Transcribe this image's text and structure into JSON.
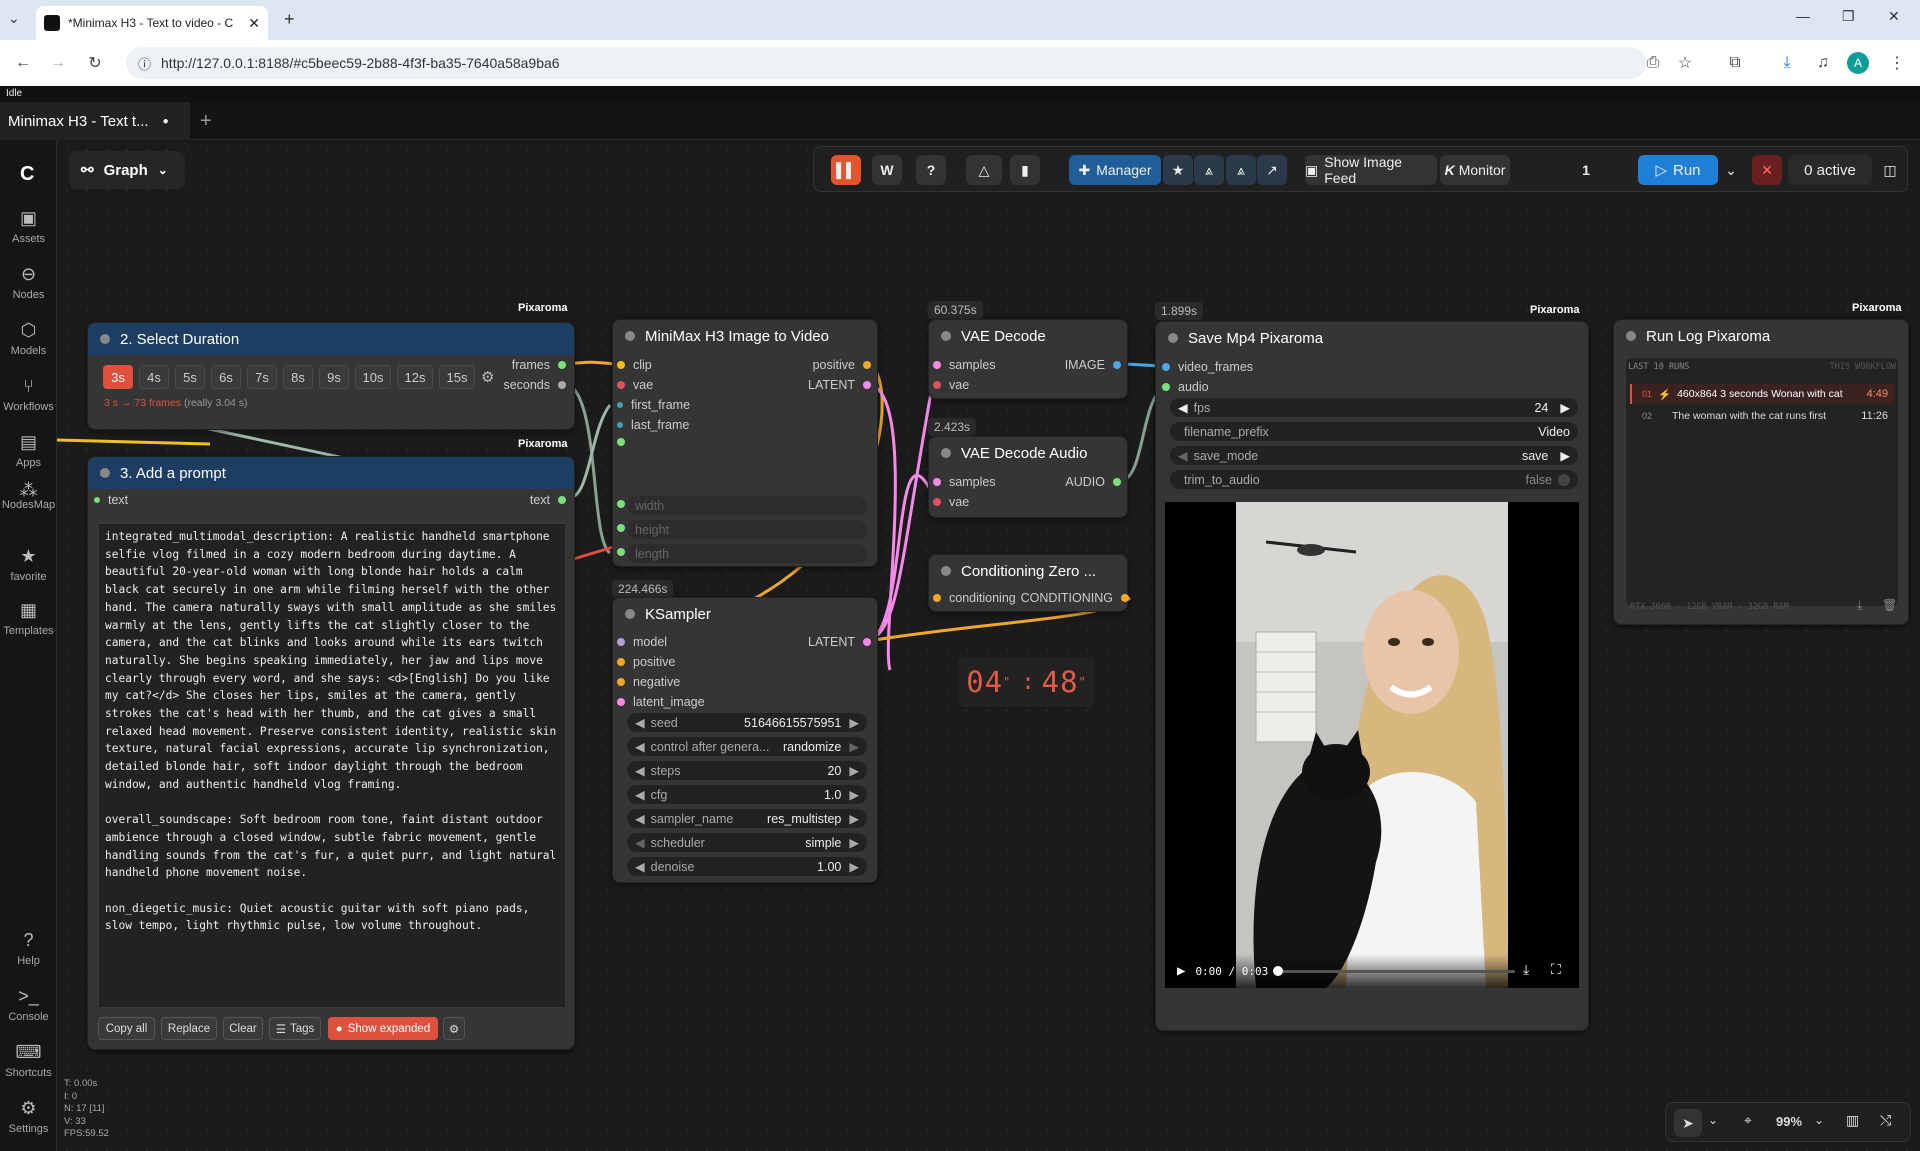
{
  "browser": {
    "tab_title": "*Minimax H3 - Text to video - C",
    "url": "http://127.0.0.1:8188/#c5beec59-2b88-4f3f-ba35-7640a58a9ba6",
    "profile_initial": "A"
  },
  "app": {
    "status": "Idle",
    "workflow_tab": "Minimax H3 - Text t...",
    "graph_label": "Graph",
    "sidebar": [
      "Assets",
      "Nodes",
      "Models",
      "Workflows",
      "Apps",
      "NodesMap",
      "favorite",
      "Templates",
      "Help",
      "Console",
      "Shortcuts",
      "Settings"
    ],
    "stats": [
      "T: 0.00s",
      "I: 0",
      "N: 17 [11]",
      "V: 33",
      "FPS:59.52"
    ],
    "zoom": "99%"
  },
  "topbar": {
    "manager": "Manager",
    "show_image_feed": "Show Image Feed",
    "monitor": "Monitor",
    "queue_count": "1",
    "run": "Run",
    "active": "0 active"
  },
  "duration_node": {
    "brand": "Pixaroma",
    "title": "2. Select Duration",
    "options": [
      "3s",
      "4s",
      "5s",
      "6s",
      "7s",
      "8s",
      "9s",
      "10s",
      "12s",
      "15s"
    ],
    "selected": "3s",
    "info_main": "3 s → 73 frames",
    "info_sub": "(really 3.04 s)",
    "out1": "frames",
    "out2": "seconds"
  },
  "prompt_node": {
    "brand": "Pixaroma",
    "title": "3. Add a prompt",
    "in": "text",
    "out": "text",
    "text": "integrated_multimodal_description: A realistic handheld smartphone\nselfie vlog filmed in a cozy modern bedroom during daytime. A\nbeautiful 20-year-old woman with long blonde hair holds a calm\nblack cat securely in one arm while filming herself with the other\nhand. The camera naturally sways with small amplitude as she smiles\nwarmly at the lens, gently lifts the cat slightly closer to the\ncamera, and the cat blinks and looks around while its ears twitch\nnaturally. She begins speaking immediately, her jaw and lips move\nclearly through every word, and she says: <d>[English] Do you like\nmy cat?</d> She closes her lips, smiles at the camera, gently\nstrokes the cat's head with her thumb, and the cat gives a small\nrelaxed head movement. Preserve consistent identity, realistic skin\ntexture, natural facial expressions, accurate lip synchronization,\ndetailed blonde hair, soft indoor daylight through the bedroom\nwindow, and authentic handheld vlog framing.\n\noverall_soundscape: Soft bedroom room tone, faint distant outdoor\nambience through a closed window, subtle fabric movement, gentle\nhandling sounds from the cat's fur, a quiet purr, and light natural\nhandheld phone movement noise.\n\nnon_diegetic_music: Quiet acoustic guitar with soft piano pads,\nslow tempo, light rhythmic pulse, low volume throughout.",
    "buttons": [
      "Copy all",
      "Replace",
      "Clear",
      "Tags",
      "Show expanded"
    ]
  },
  "minimax_node": {
    "title": "MiniMax H3 Image to Video",
    "inputs": [
      "clip",
      "vae",
      "first_frame",
      "last_frame"
    ],
    "outputs": [
      "positive",
      "LATENT"
    ],
    "widgets": [
      "width",
      "height",
      "length"
    ]
  },
  "ksampler": {
    "time": "224.466s",
    "title": "KSampler",
    "inputs": [
      "model",
      "positive",
      "negative",
      "latent_image"
    ],
    "output": "LATENT",
    "widgets": [
      {
        "label": "seed",
        "value": "51646615575951"
      },
      {
        "label": "control after genera...",
        "value": "randomize"
      },
      {
        "label": "steps",
        "value": "20"
      },
      {
        "label": "cfg",
        "value": "1.0"
      },
      {
        "label": "sampler_name",
        "value": "res_multistep"
      },
      {
        "label": "scheduler",
        "value": "simple"
      },
      {
        "label": "denoise",
        "value": "1.00"
      }
    ]
  },
  "vae_decode": {
    "time": "60.375s",
    "title": "VAE Decode",
    "inputs": [
      "samples",
      "vae"
    ],
    "output": "IMAGE"
  },
  "vae_decode_audio": {
    "time": "2.423s",
    "title": "VAE Decode Audio",
    "inputs": [
      "samples",
      "vae"
    ],
    "output": "AUDIO"
  },
  "cond_zero": {
    "title": "Conditioning Zero ...",
    "input": "conditioning",
    "output": "CONDITIONING"
  },
  "timer": {
    "minutes": "04",
    "seconds": "48"
  },
  "save_mp4": {
    "time": "1.899s",
    "brand": "Pixaroma",
    "title": "Save Mp4 Pixaroma",
    "inputs": [
      "video_frames",
      "audio"
    ],
    "widgets": [
      {
        "label": "fps",
        "value": "24"
      },
      {
        "label": "filename_prefix",
        "value": "Video"
      },
      {
        "label": "save_mode",
        "value": "save"
      },
      {
        "label": "trim_to_audio",
        "value": "false"
      }
    ],
    "player_time": "0:00 / 0:03"
  },
  "run_log": {
    "brand": "Pixaroma",
    "title": "Run Log Pixaroma",
    "header_left": "LAST 10 RUNS",
    "header_right": "THIS WORKFLOW",
    "runs": [
      {
        "n": "01",
        "text": "460x864 3 seconds Wonan with cat",
        "dur": "4:49"
      },
      {
        "n": "02",
        "text": "The woman with the cat runs first",
        "dur": "11:26"
      }
    ],
    "footer": "RTX 3060 · 12GB VRAM · 32GB RAM"
  },
  "colors": {
    "accent": "#1f7fd6",
    "danger": "#e0513d",
    "node_header": "#1d3d63"
  }
}
